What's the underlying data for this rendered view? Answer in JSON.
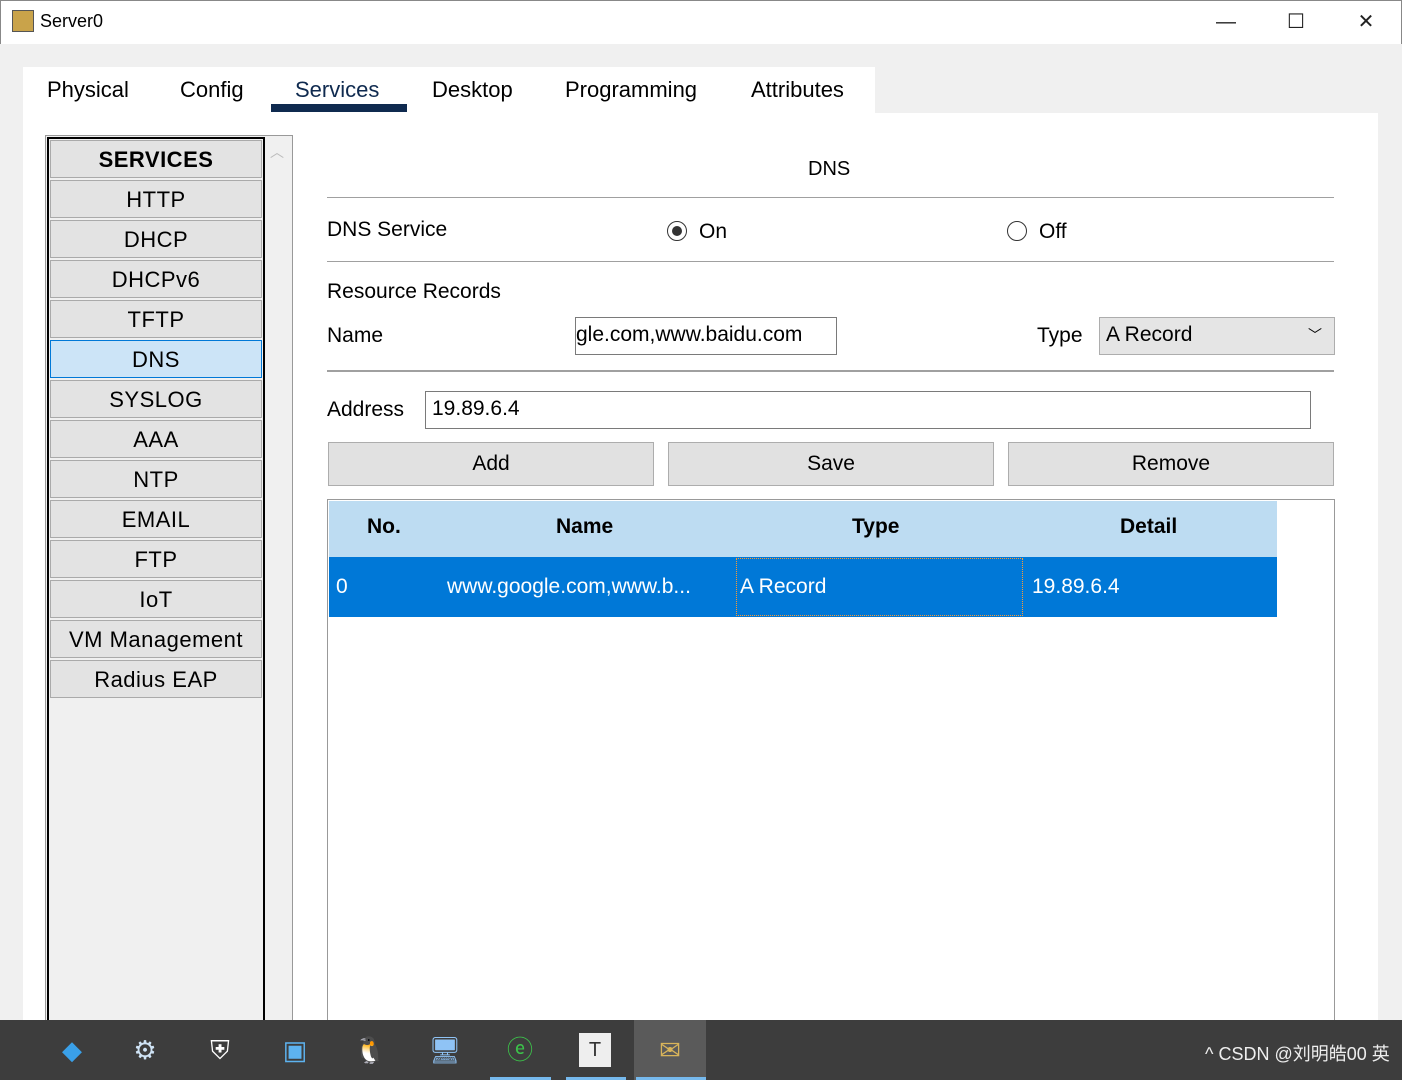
{
  "window": {
    "title": "Server0",
    "minimize": "—",
    "maximize": "☐",
    "close": "✕"
  },
  "tabs": [
    {
      "label": "Physical"
    },
    {
      "label": "Config"
    },
    {
      "label": "Services",
      "active": true
    },
    {
      "label": "Desktop"
    },
    {
      "label": "Programming"
    },
    {
      "label": "Attributes"
    }
  ],
  "sidebar": {
    "header": "SERVICES",
    "items": [
      "HTTP",
      "DHCP",
      "DHCPv6",
      "TFTP",
      "DNS",
      "SYSLOG",
      "AAA",
      "NTP",
      "EMAIL",
      "FTP",
      "IoT",
      "VM Management",
      "Radius EAP"
    ],
    "selected": "DNS"
  },
  "dns": {
    "title": "DNS",
    "service_label": "DNS Service",
    "on_label": "On",
    "off_label": "Off",
    "service_state": "On",
    "records_label": "Resource Records",
    "name_label": "Name",
    "name_value": "gle.com,www.baidu.com",
    "type_label": "Type",
    "type_value": "A Record",
    "address_label": "Address",
    "address_value": "19.89.6.4",
    "add": "Add",
    "save": "Save",
    "remove": "Remove"
  },
  "table": {
    "columns": [
      "No.",
      "Name",
      "Type",
      "Detail"
    ],
    "rows": [
      {
        "no": "0",
        "name": "www.google.com,www.b...",
        "type": "A Record",
        "detail": "19.89.6.4"
      }
    ]
  },
  "taskbar": {
    "tray_text": "^  CSDN @刘明皓00  英"
  },
  "colors": {
    "accent": "#0078d7",
    "header": "#bddcf2",
    "tab_underline": "#0f2a4f"
  }
}
